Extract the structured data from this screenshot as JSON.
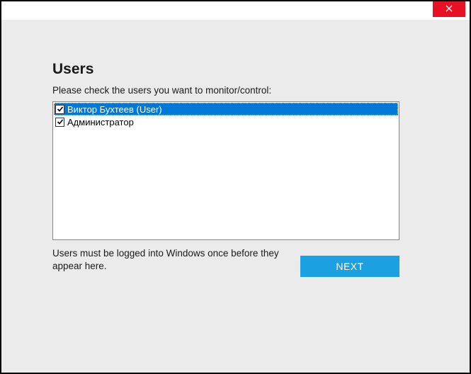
{
  "titlebar": {
    "close_icon": "close"
  },
  "heading": "Users",
  "instruction": "Please check the users you want to monitor/control:",
  "users": [
    {
      "label": "Виктор Бухтеев (User)",
      "checked": true,
      "selected": true
    },
    {
      "label": "Администратор",
      "checked": true,
      "selected": false
    }
  ],
  "hint": "Users must be logged into Windows once before they appear here.",
  "next_label": "NEXT"
}
